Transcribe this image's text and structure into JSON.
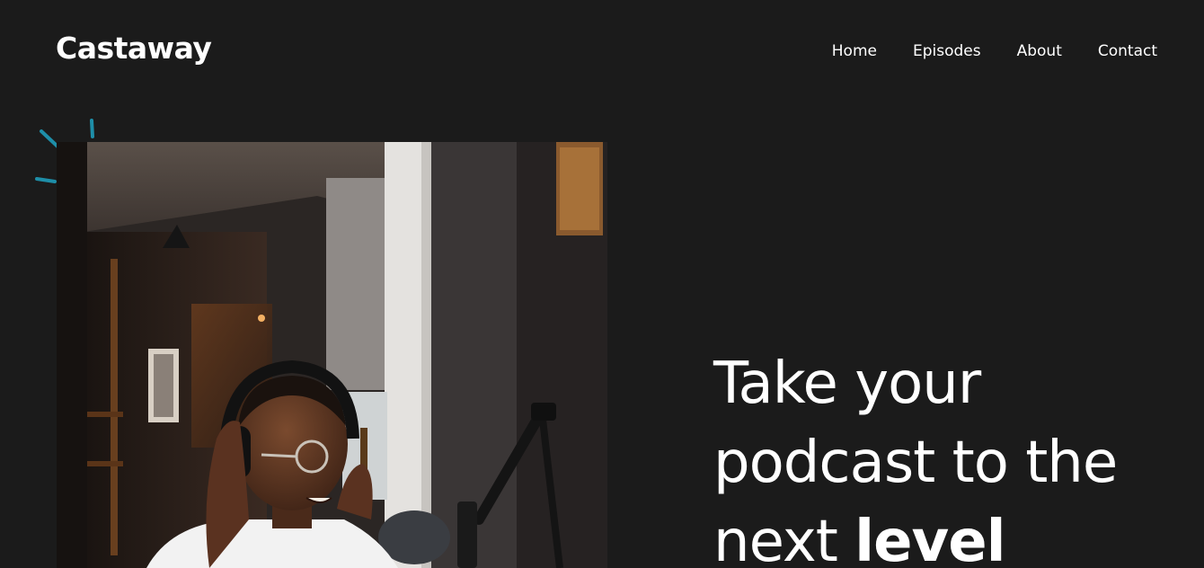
{
  "header": {
    "logo": "Castaway",
    "nav": [
      "Home",
      "Episodes",
      "About",
      "Contact"
    ]
  },
  "hero": {
    "line1": "Take your",
    "line2": "podcast to the",
    "line3_light": "next",
    "line3_bold": "level"
  },
  "colors": {
    "background": "#1b1b1b",
    "text": "#ffffff",
    "accent": "#1e8ea8"
  }
}
